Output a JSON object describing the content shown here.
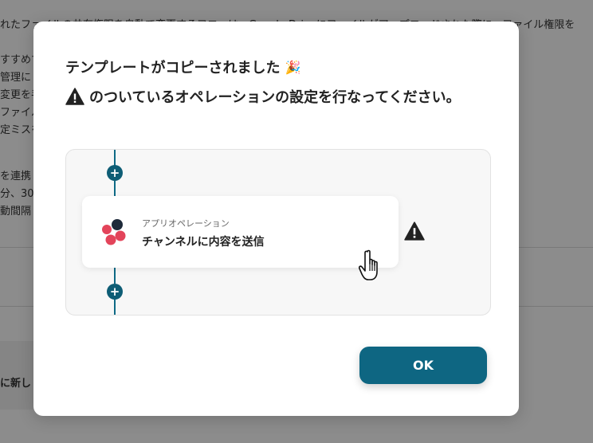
{
  "background": {
    "top_line": "れたファイルの共有権限を自動で変更するフローは、Google Driveにファイルがアップロードされた際に、ファイル権限を",
    "left_fragments": [
      "すすめす",
      "管理に",
      "変更を手",
      "ファイル",
      "定ミスを",
      "を連携",
      "分、30",
      "動間隔"
    ],
    "bottom_card_text": "に新し"
  },
  "modal": {
    "title": "テンプレートがコピーされました",
    "title_emoji": "🎉",
    "instruction": "のついているオペレーションの設定を行なってください。",
    "flow": {
      "operation_type": "アプリオペレーション",
      "operation_name": "チャンネルに内容を送信",
      "add_label": "+"
    },
    "ok_label": "OK"
  },
  "colors": {
    "accent": "#0e6682",
    "connector": "#0e6a86",
    "logo_dark": "#1e2a3a",
    "logo_red": "#e3445a"
  },
  "icons": [
    "party-popper-icon",
    "warning-icon",
    "app-logo-icon",
    "plus-icon",
    "hand-pointer-icon"
  ]
}
